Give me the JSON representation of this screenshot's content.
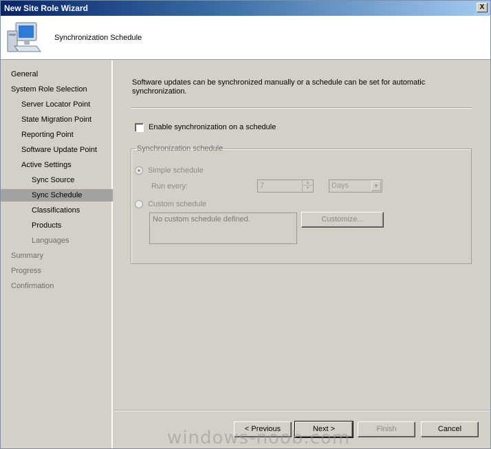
{
  "window": {
    "title": "New Site Role Wizard",
    "close_glyph": "X"
  },
  "header": {
    "title": "Synchronization Schedule",
    "icon": "computer-icon"
  },
  "sidebar": {
    "items": [
      {
        "label": "General",
        "level": 0,
        "state": "normal"
      },
      {
        "label": "System Role Selection",
        "level": 0,
        "state": "normal"
      },
      {
        "label": "Server Locator Point",
        "level": 1,
        "state": "normal"
      },
      {
        "label": "State Migration Point",
        "level": 1,
        "state": "normal"
      },
      {
        "label": "Reporting Point",
        "level": 1,
        "state": "normal"
      },
      {
        "label": "Software Update Point",
        "level": 1,
        "state": "normal"
      },
      {
        "label": "Active Settings",
        "level": 1,
        "state": "normal"
      },
      {
        "label": "Sync Source",
        "level": 2,
        "state": "normal"
      },
      {
        "label": "Sync Schedule",
        "level": 2,
        "state": "selected"
      },
      {
        "label": "Classifications",
        "level": 2,
        "state": "normal"
      },
      {
        "label": "Products",
        "level": 2,
        "state": "normal"
      },
      {
        "label": "Languages",
        "level": 2,
        "state": "disabled"
      },
      {
        "label": "Summary",
        "level": 0,
        "state": "disabled"
      },
      {
        "label": "Progress",
        "level": 0,
        "state": "disabled"
      },
      {
        "label": "Confirmation",
        "level": 0,
        "state": "disabled"
      }
    ]
  },
  "content": {
    "description": "Software updates can be synchronized manually or a schedule can be set for automatic synchronization.",
    "enable_checkbox": {
      "label": "Enable synchronization on a schedule",
      "checked": false
    },
    "group": {
      "legend": "Synchronization schedule",
      "simple": {
        "label": "Simple schedule",
        "selected": true,
        "enabled": false
      },
      "run_every": {
        "label": "Run every:",
        "value": "7",
        "unit": "Days"
      },
      "custom": {
        "label": "Custom schedule",
        "selected": false,
        "enabled": false
      },
      "custom_text": "No custom schedule defined.",
      "customize_label": "Customize..."
    }
  },
  "footer": {
    "previous": "< Previous",
    "next": "Next >",
    "finish": "Finish",
    "cancel": "Cancel"
  },
  "watermark": "windows-noob.com"
}
